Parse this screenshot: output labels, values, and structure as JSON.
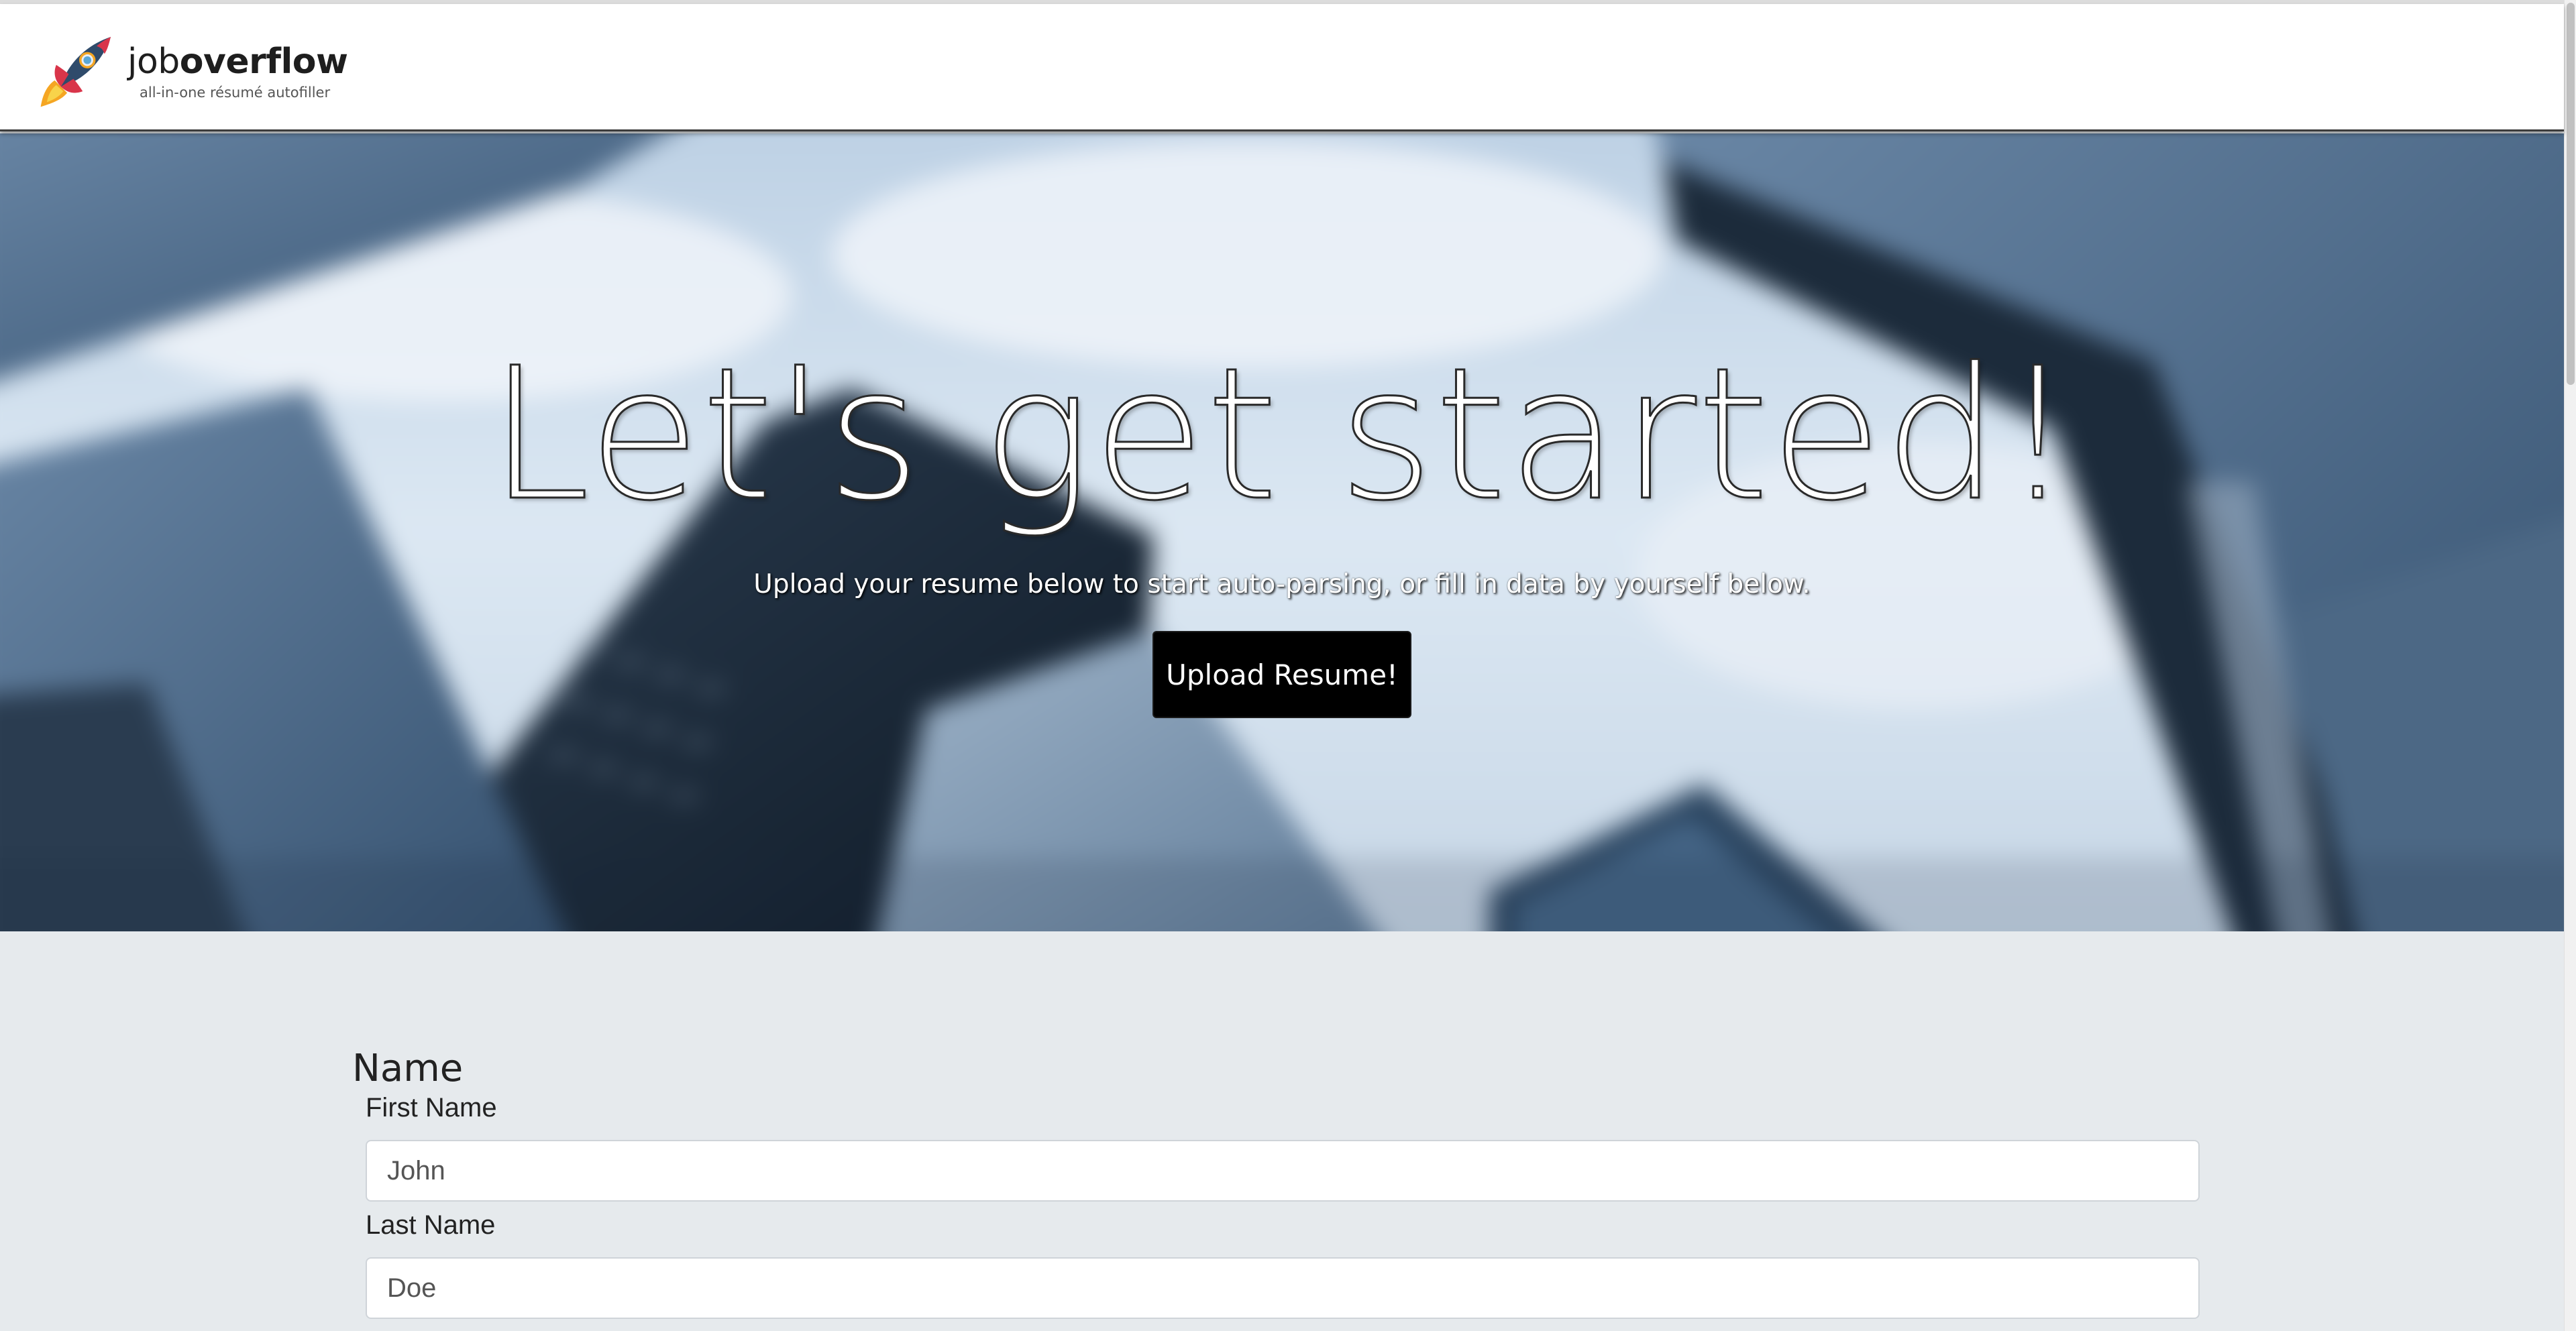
{
  "header": {
    "brand_light": "job",
    "brand_bold": "overflow",
    "tagline": "all-in-one résumé autofiller",
    "logo_icon": "rocket-icon"
  },
  "hero": {
    "title": "Let's get started!",
    "subtitle": "Upload your resume below to start auto-parsing, or fill in data by yourself below.",
    "upload_label": "Upload Resume!"
  },
  "form": {
    "section_title": "Name",
    "first_name": {
      "label": "First Name",
      "placeholder": "John"
    },
    "last_name": {
      "label": "Last Name",
      "placeholder": "Doe"
    }
  },
  "colors": {
    "header_bg": "#ffffff",
    "button_bg": "#000000",
    "form_bg": "#e6eaed",
    "input_bg": "#ffffff"
  }
}
